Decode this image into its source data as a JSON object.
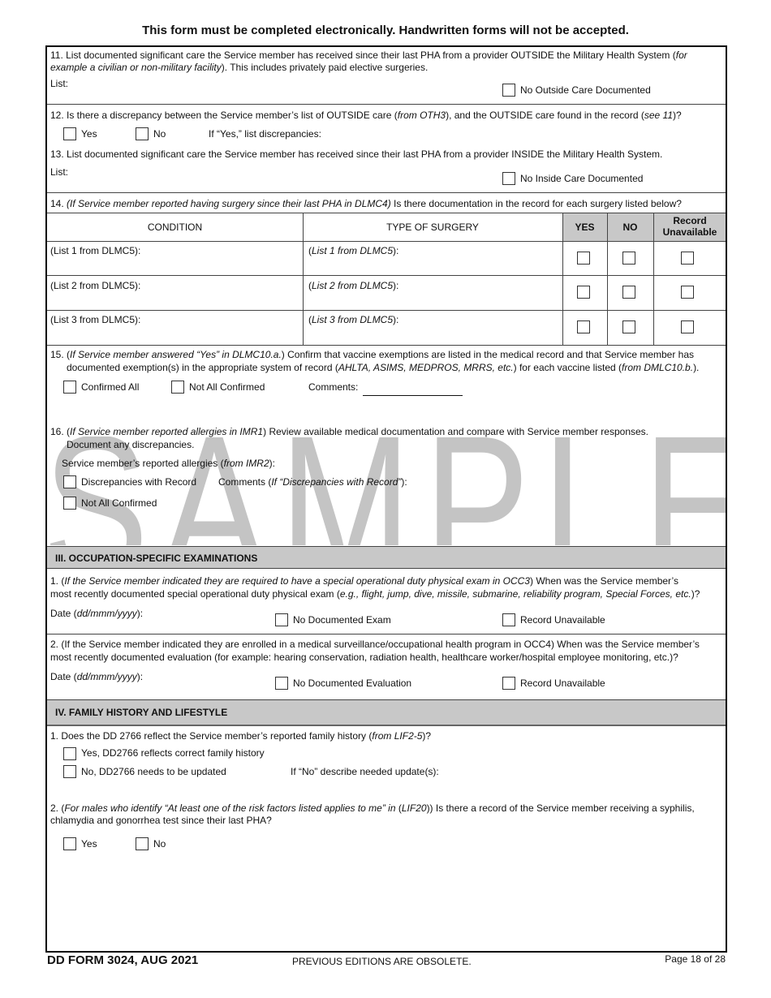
{
  "banner": "This form must be completed electronically. Handwritten forms will not be accepted.",
  "watermark": "SAMPLE",
  "q11": {
    "text_a": "11. List documented significant care the Service member has received since their last PHA from a provider OUTSIDE the Military Health System (",
    "text_i": "for example a civilian or non-military facility",
    "text_b": "). This includes privately paid elective surgeries.",
    "list_label": "List:",
    "checkbox": "No Outside Care Documented"
  },
  "q12": {
    "text_a": "12. Is there a discrepancy between the Service member’s list of OUTSIDE care (",
    "i1": "from OTH3",
    "text_b": "), and the OUTSIDE care found in the record (",
    "i2": "see 11",
    "text_c": ")?",
    "yes": "Yes",
    "no": "No",
    "note": "If “Yes,” list discrepancies:"
  },
  "q13": {
    "text": "13. List documented significant care the Service member has received since their last PHA from a provider INSIDE the Military Health System.",
    "list_label": "List:",
    "checkbox": "No Inside Care Documented"
  },
  "q14": {
    "num": "14. ",
    "i": "(If Service member reported having surgery since their last PHA in DLMC4)",
    "text": " Is there documentation in the record for each surgery listed below?",
    "headers": [
      "CONDITION",
      "TYPE OF SURGERY",
      "YES",
      "NO",
      "Record Unavailable"
    ],
    "rows": [
      {
        "condition": "(List 1 from DLMC5):",
        "surgery_a": "(",
        "surgery_i": "List 1 from DLMC5",
        "surgery_b": "):"
      },
      {
        "condition": "(List 2 from DLMC5):",
        "surgery_a": "(",
        "surgery_i": "List 2 from DLMC5",
        "surgery_b": "):"
      },
      {
        "condition": "(List 3 from DLMC5):",
        "surgery_a": "(",
        "surgery_i": "List 3 from DLMC5",
        "surgery_b": "):"
      }
    ]
  },
  "q15": {
    "a": "15. (",
    "i1": "If Service member answered “Yes” in DLMC10.a.",
    "b": ") Confirm that vaccine exemptions are listed in the medical record and that Service member has",
    "c": "documented exemption(s) in the appropriate system of record (",
    "i2": "AHLTA, ASIMS, MEDPROS, MRRS, etc.",
    "d": ") for each vaccine listed (",
    "i3": "from DMLC10.b.",
    "e": ").",
    "confirmed": "Confirmed All",
    "not_confirmed": "Not All Confirmed",
    "comments": "Comments:"
  },
  "q16": {
    "a": "16. (",
    "i1": "If Service member reported allergies in IMR1",
    "b": ") Review available medical documentation and compare with Service member responses.",
    "c": "Document any discrepancies.",
    "allergies_a": "Service member’s reported allergies (",
    "allergies_i": "from IMR2",
    "allergies_b": "):",
    "discrepancies": "Discrepancies with Record",
    "comments_a": "Comments (",
    "comments_i": "If “Discrepancies with Record”",
    "comments_b": "):",
    "not_confirmed": "Not All Confirmed"
  },
  "sec3": {
    "title": "III. OCCUPATION-SPECIFIC EXAMINATIONS",
    "q1": {
      "a": "1. (",
      "i1": "If the Service member indicated they are required to have a special operational duty physical exam in OCC3",
      "b": ") When was the Service member’s",
      "c": "most recently documented special operational duty physical exam (",
      "i2": "e.g., flight, jump, dive, missile, submarine, reliability program, Special Forces, etc.",
      "d": ")?",
      "date_a": "Date (",
      "date_i": "dd/mmm/yyyy",
      "date_b": "):",
      "cb1": "No Documented Exam",
      "cb2": "Record Unavailable"
    },
    "q2": {
      "line1": "2. (If the Service member indicated they are enrolled in a medical surveillance/occupational health program in OCC4) When was the Service member’s",
      "line2": "most recently documented evaluation (for example: hearing conservation, radiation health, healthcare worker/hospital employee monitoring, etc.)?",
      "date_a": "Date (",
      "date_i": "dd/mmm/yyyy",
      "date_b": "):",
      "cb1": "No Documented Evaluation",
      "cb2": "Record Unavailable"
    }
  },
  "sec4": {
    "title": "IV. FAMILY HISTORY AND LIFESTYLE",
    "q1": {
      "a": "1. Does the DD 2766 reflect the Service member’s reported family history (",
      "i": "from LIF2-5",
      "b": ")?",
      "yes": "Yes, DD2766 reflects correct family history",
      "no": "No, DD2766 needs to be updated",
      "note": "If “No” describe needed update(s):"
    },
    "q2": {
      "a": "2. (",
      "i1": "For males who identify “At least one of the risk factors listed applies to me” in",
      "b": " (",
      "i2": "LIF20",
      "c": ")) Is there a record of the Service member receiving a syphilis,",
      "d": "chlamydia and gonorrhea test since their last PHA?",
      "yes": "Yes",
      "no": "No"
    }
  },
  "footer": {
    "form": "DD FORM 3024, AUG 2021",
    "obsolete": "PREVIOUS EDITIONS ARE OBSOLETE.",
    "page": "Page 18 of 28"
  }
}
